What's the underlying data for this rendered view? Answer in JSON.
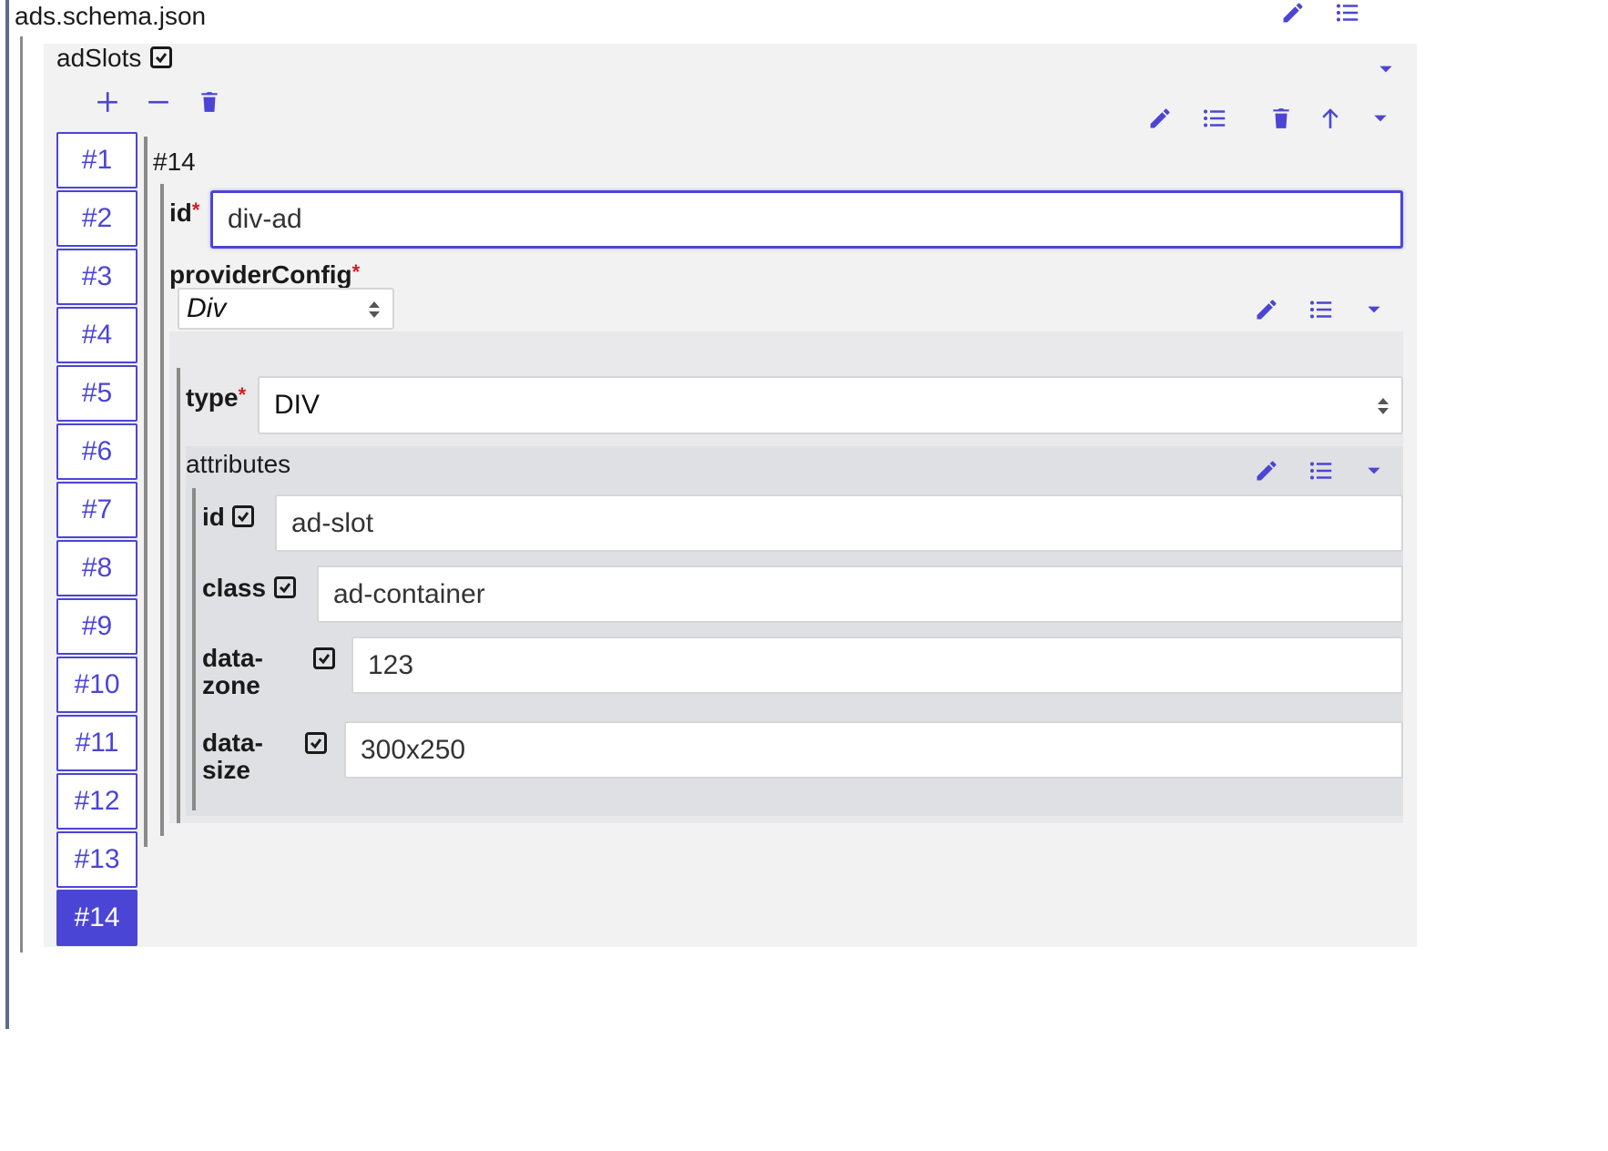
{
  "file": {
    "title": "ads.schema.json"
  },
  "array": {
    "title": "adSlots",
    "tabs": [
      "#1",
      "#2",
      "#3",
      "#4",
      "#5",
      "#6",
      "#7",
      "#8",
      "#9",
      "#10",
      "#11",
      "#12",
      "#13",
      "#14"
    ],
    "active_tab": "#14"
  },
  "item": {
    "title": "#14",
    "id": {
      "label": "id",
      "required_mark": "*",
      "value": "div-ad"
    },
    "providerConfig": {
      "label": "providerConfig",
      "required_mark": "*",
      "selected": "Div",
      "type": {
        "label": "type",
        "required_mark": "*",
        "value": "DIV"
      },
      "attributes": {
        "title": "attributes",
        "fields": [
          {
            "label": "id",
            "value": "ad-slot"
          },
          {
            "label": "class",
            "value": "ad-container"
          },
          {
            "label_line1": "data-",
            "label_line2": "zone",
            "value": "123"
          },
          {
            "label_line1": "data-",
            "label_line2": "size",
            "value": "300x250"
          }
        ]
      }
    }
  },
  "icons": {
    "edit": "pencil-icon",
    "properties": "list-icon",
    "delete": "trash-icon",
    "move_up": "arrow-up-icon",
    "collapse": "caret-down-icon",
    "add": "plus-icon",
    "remove": "minus-icon"
  },
  "colors": {
    "accent": "#4b45d6",
    "required": "#d81b1b",
    "panel": "#f2f2f3",
    "panel_dark": "#e2e3e6"
  }
}
